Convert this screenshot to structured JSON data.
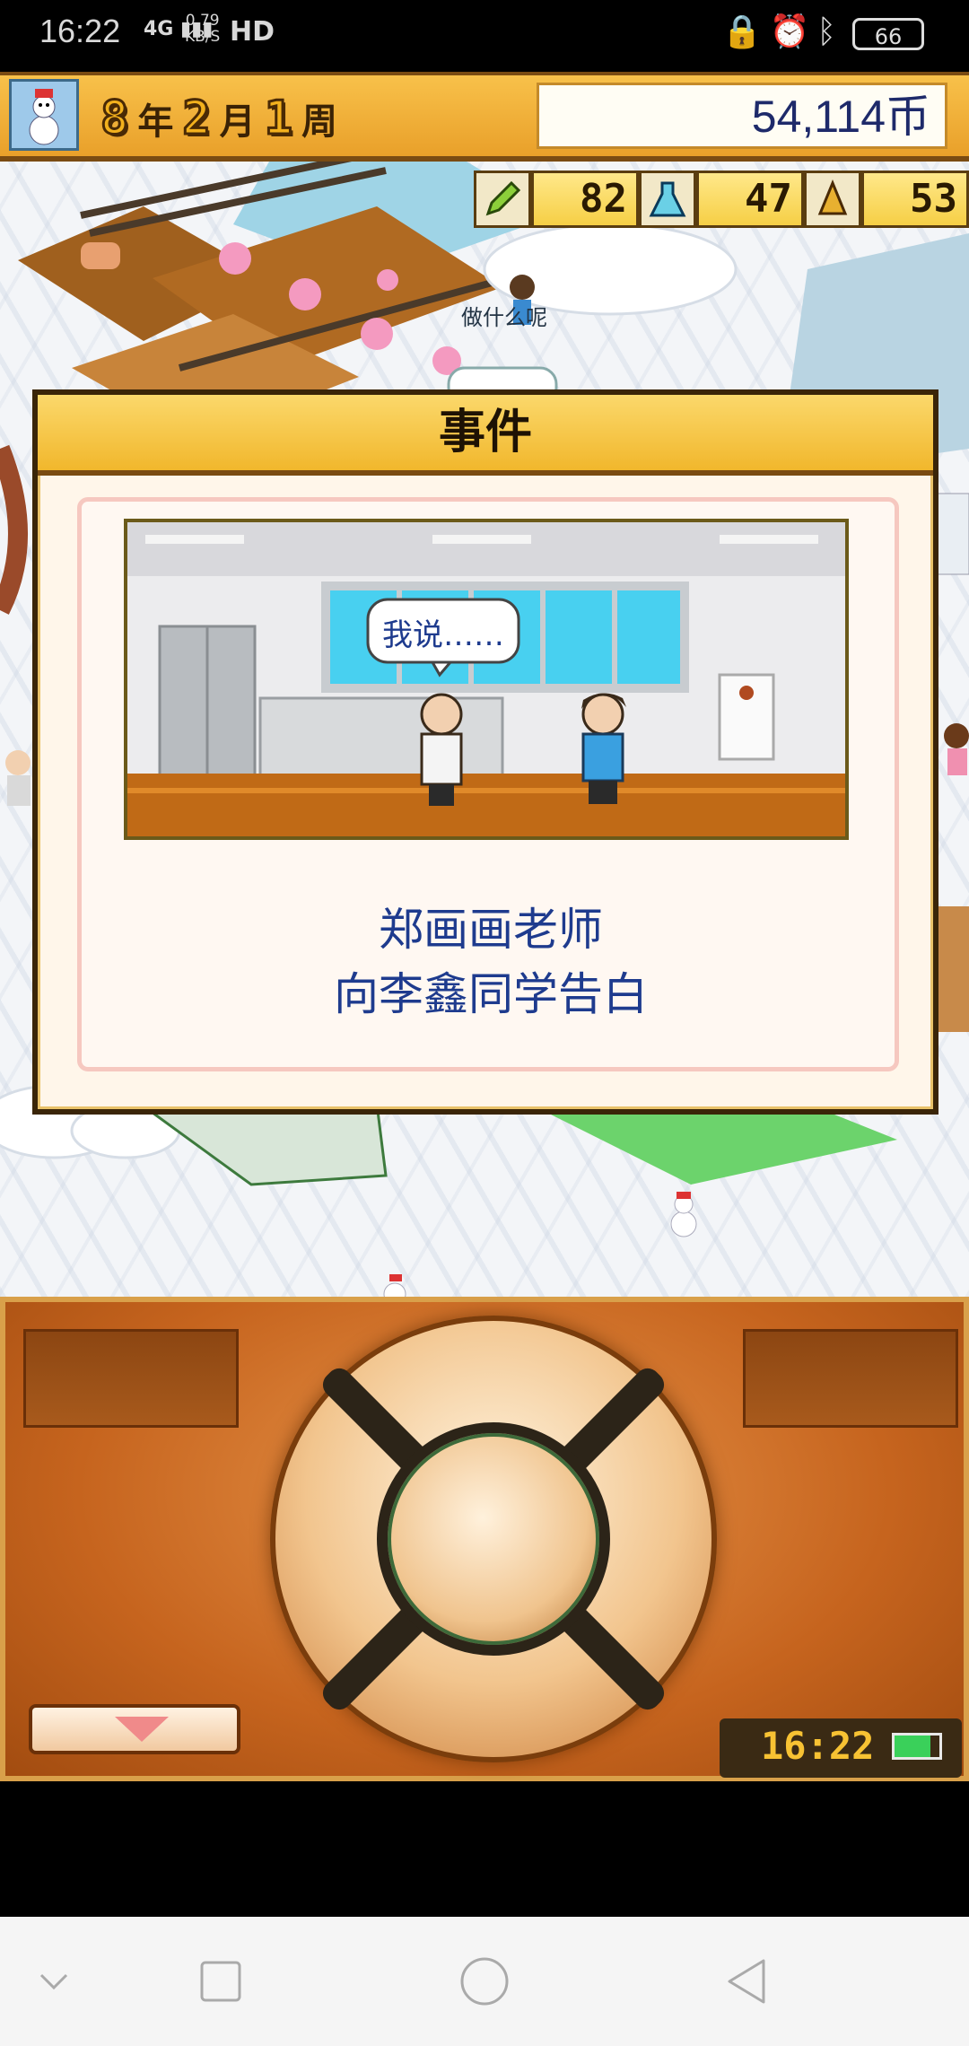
{
  "status_bar": {
    "time": "16:22",
    "network": "4G",
    "rate": "0.79",
    "rate_unit": "KB/S",
    "hd": "HD",
    "battery": "66",
    "icons": [
      "lock-icon",
      "alarm-icon",
      "bluetooth-icon"
    ]
  },
  "hud": {
    "year": "8",
    "year_unit": "年",
    "month": "2",
    "month_unit": "月",
    "week": "1",
    "week_unit": "周",
    "money": "54,114币",
    "stats": [
      {
        "icon": "pencil-icon",
        "value": "82"
      },
      {
        "icon": "flask-icon",
        "value": "47"
      },
      {
        "icon": "bell-icon",
        "value": "53"
      }
    ]
  },
  "world": {
    "speech_partial": "做什么呢"
  },
  "event": {
    "title": "事件",
    "bubble": "我说……",
    "line1": "郑画画老师",
    "line2": "向李鑫同学告白"
  },
  "controller": {
    "clock": "16:22"
  },
  "nav": {
    "icons": [
      "chevron-down-icon",
      "square-icon",
      "circle-icon",
      "triangle-back-icon"
    ]
  }
}
